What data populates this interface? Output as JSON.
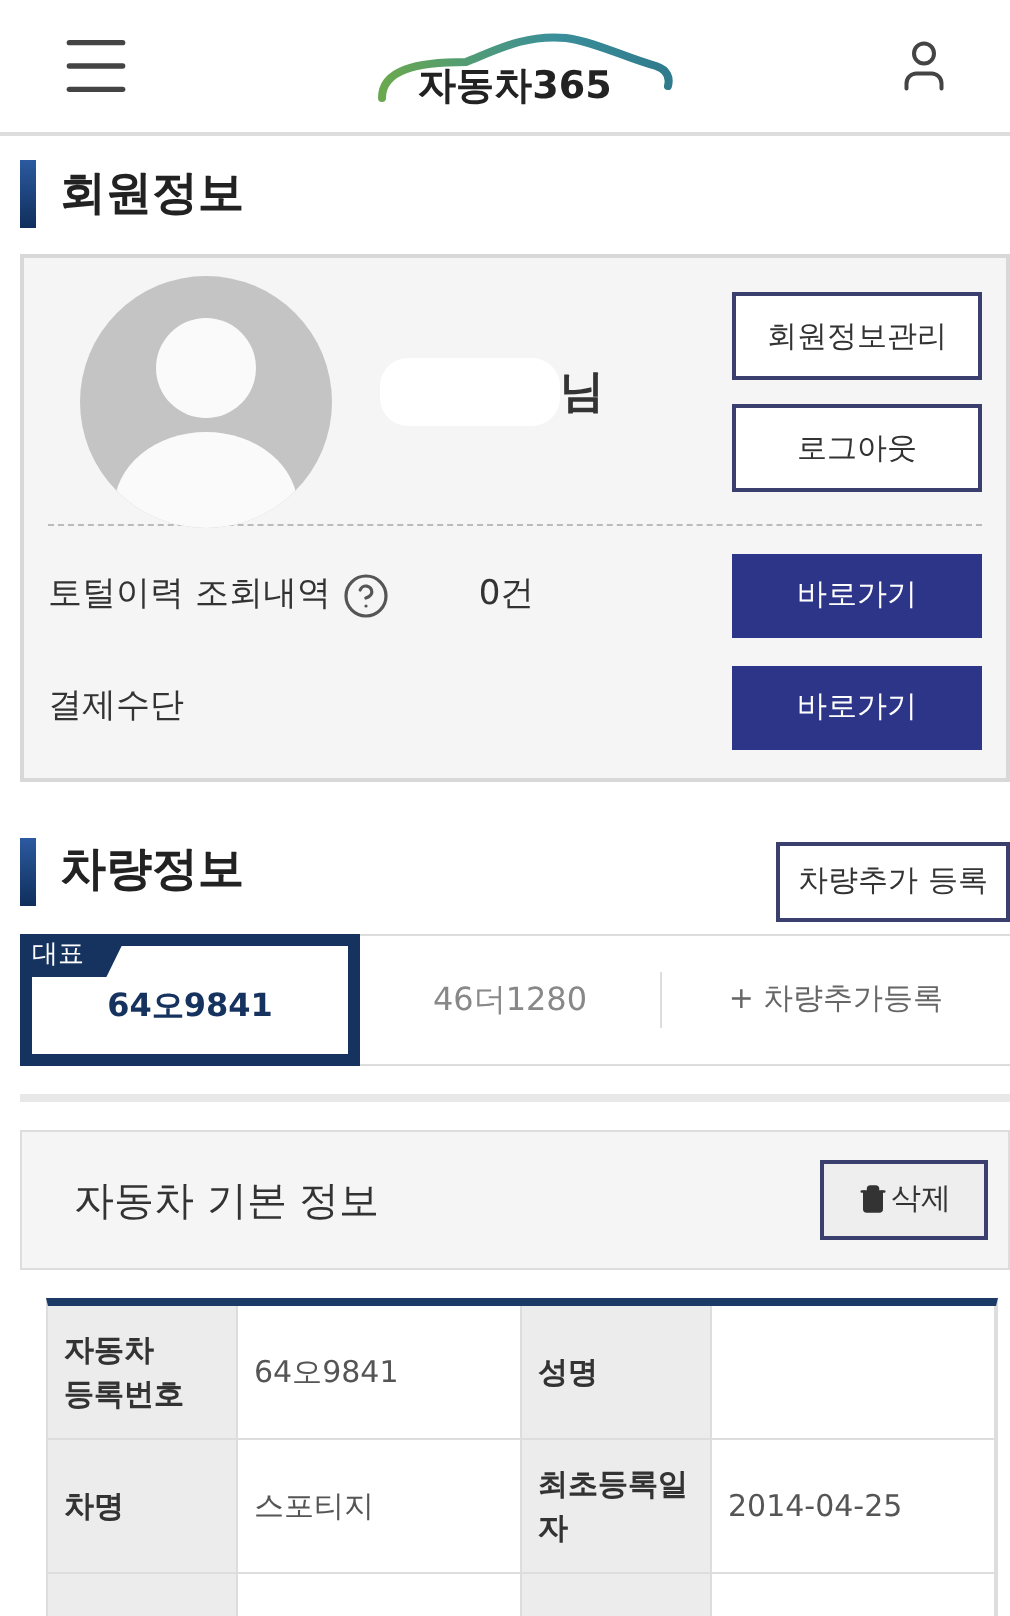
{
  "header": {
    "logo_text": "자동차365"
  },
  "member": {
    "title": "회원정보",
    "name_suffix": "님",
    "buttons": [
      "회원정보관리",
      "로그아웃"
    ],
    "rows": [
      {
        "label": "토털이력 조회내역",
        "help": true,
        "count": "0건",
        "action": "바로가기"
      },
      {
        "label": "결제수단",
        "help": false,
        "action": "바로가기"
      }
    ]
  },
  "vehicles": {
    "title": "차량정보",
    "add_button": "차량추가 등록",
    "tabs": [
      {
        "label": "64오9841",
        "selected": true,
        "badge": "대표"
      },
      {
        "label": "46더1280",
        "selected": false
      }
    ],
    "add_tab": "+ 차량추가등록",
    "info_title": "자동차 기본 정보",
    "delete_button": "삭제",
    "table": [
      [
        {
          "kind": "header",
          "text": "자동차 등록번호"
        },
        {
          "kind": "value",
          "text": "64오9841"
        },
        {
          "kind": "header",
          "text": "성명"
        },
        {
          "kind": "value"
        }
      ],
      [
        {
          "kind": "header",
          "text": "차명"
        },
        {
          "kind": "value",
          "text": "스포티지"
        },
        {
          "kind": "header",
          "text": "최초등록일자"
        },
        {
          "kind": "value",
          "text": "2014-04-25"
        }
      ],
      [
        {
          "kind": "header"
        },
        {
          "kind": "value"
        },
        {
          "kind": "header"
        },
        {
          "kind": "value"
        }
      ]
    ]
  }
}
